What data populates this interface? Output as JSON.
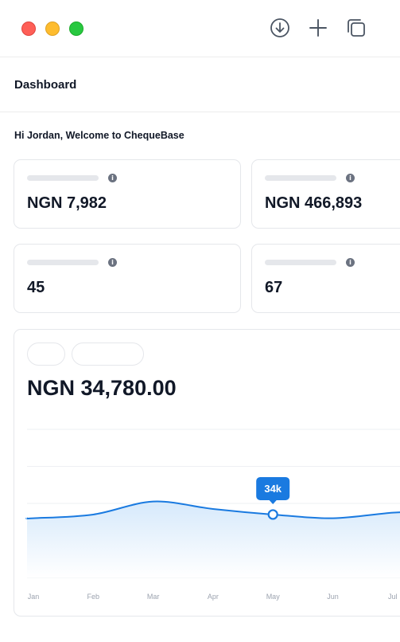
{
  "window": {
    "controls": [
      "close",
      "minimize",
      "maximize"
    ],
    "toolbar_icons": [
      "download-icon",
      "plus-icon",
      "copy-icon"
    ]
  },
  "header": {
    "title": "Dashboard"
  },
  "welcome": "Hi Jordan, Welcome to ChequeBase",
  "stats": [
    {
      "value": "NGN 7,982"
    },
    {
      "value": "NGN 466,893"
    },
    {
      "value": "45"
    },
    {
      "value": "67"
    }
  ],
  "chart": {
    "total": "NGN 34,780.00",
    "tooltip": "34k",
    "colors": {
      "line": "#1a7ae0",
      "tooltip": "#1a7ae0",
      "fill_top": "#d6e9fb"
    }
  },
  "chart_data": {
    "type": "area",
    "x": [
      "Jan",
      "Feb",
      "Mar",
      "Apr",
      "May",
      "Jun",
      "Jul"
    ],
    "values": [
      32,
      34,
      41,
      37,
      34,
      32,
      35
    ],
    "ylim": [
      0,
      80
    ],
    "grid": true,
    "highlight": {
      "x": "May",
      "label": "34k"
    }
  }
}
